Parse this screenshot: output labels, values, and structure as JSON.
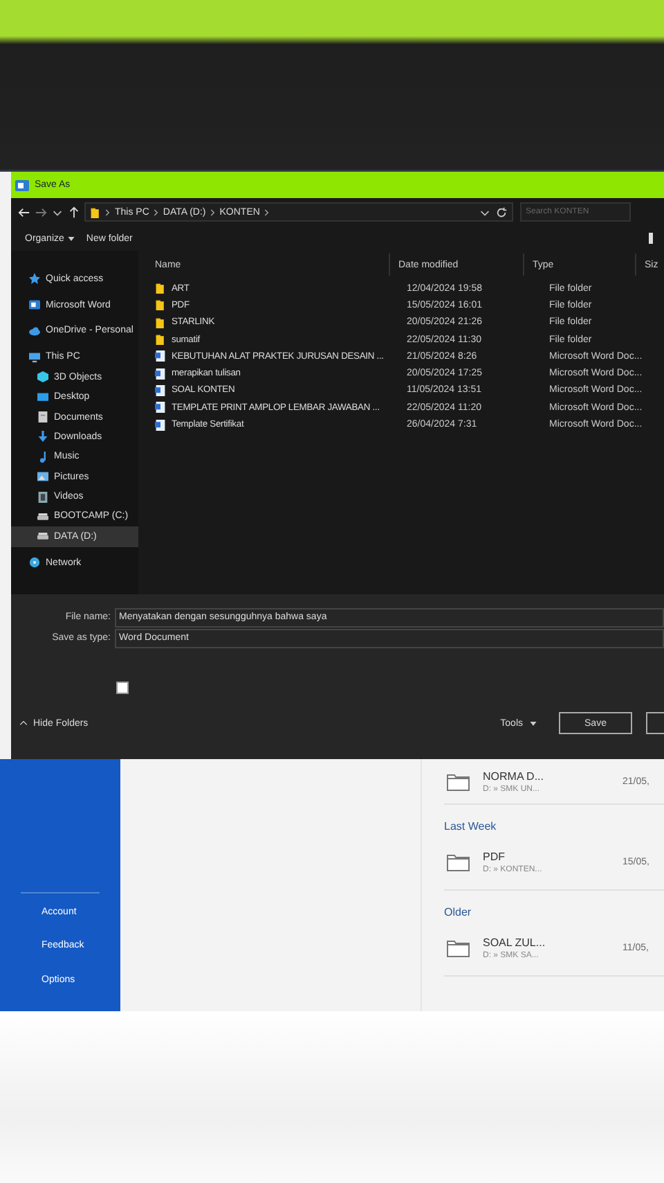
{
  "window": {
    "title": "Save As"
  },
  "nav": {
    "breadcrumb": [
      "This PC",
      "DATA (D:)",
      "KONTEN"
    ],
    "search": {
      "placeholder": "Search KONTEN"
    }
  },
  "toolbar": {
    "organize": "Organize",
    "new_folder": "New folder"
  },
  "columns": [
    "Name",
    "Date modified",
    "Type",
    "Siz"
  ],
  "sidebar": {
    "items": [
      {
        "label": "Quick access",
        "kind": "star",
        "selected": false
      },
      {
        "label": "Microsoft Word",
        "kind": "word",
        "selected": false
      },
      {
        "label": "OneDrive - Personal",
        "kind": "cloud",
        "selected": false
      },
      {
        "label": "This PC",
        "kind": "pc",
        "selected": false,
        "children": [
          {
            "label": "3D Objects",
            "kind": "cube",
            "selected": false
          },
          {
            "label": "Desktop",
            "kind": "desktop",
            "selected": false
          },
          {
            "label": "Documents",
            "kind": "doc",
            "selected": false
          },
          {
            "label": "Downloads",
            "kind": "download",
            "selected": false
          },
          {
            "label": "Music",
            "kind": "music",
            "selected": false
          },
          {
            "label": "Pictures",
            "kind": "picture",
            "selected": false
          },
          {
            "label": "Videos",
            "kind": "video",
            "selected": false
          },
          {
            "label": "BOOTCAMP (C:)",
            "kind": "drive",
            "selected": false
          },
          {
            "label": "DATA (D:)",
            "kind": "drive",
            "selected": true
          }
        ]
      },
      {
        "label": "Network",
        "kind": "network",
        "selected": false
      }
    ]
  },
  "files": [
    {
      "name": "ART",
      "date": "12/04/2024 19:58",
      "type": "File folder",
      "kind": "folder"
    },
    {
      "name": "PDF",
      "date": "15/05/2024 16:01",
      "type": "File folder",
      "kind": "folder"
    },
    {
      "name": "STARLINK",
      "date": "20/05/2024 21:26",
      "type": "File folder",
      "kind": "folder"
    },
    {
      "name": "sumatif",
      "date": "22/05/2024 11:30",
      "type": "File folder",
      "kind": "folder"
    },
    {
      "name": "KEBUTUHAN ALAT PRAKTEK JURUSAN DESAIN ...",
      "date": "21/05/2024 8:26",
      "type": "Microsoft Word Doc...",
      "kind": "doc"
    },
    {
      "name": "merapikan tulisan",
      "date": "20/05/2024 17:25",
      "type": "Microsoft Word Doc...",
      "kind": "doc"
    },
    {
      "name": "SOAL KONTEN",
      "date": "11/05/2024 13:51",
      "type": "Microsoft Word Doc...",
      "kind": "doc"
    },
    {
      "name": "TEMPLATE PRINT AMPLOP LEMBAR JAWABAN ...",
      "date": "22/05/2024 11:20",
      "type": "Microsoft Word Doc...",
      "kind": "doc"
    },
    {
      "name": "Template Sertifikat",
      "date": "26/04/2024 7:31",
      "type": "Microsoft Word Doc...",
      "kind": "doc"
    }
  ],
  "form": {
    "file_name": {
      "label": "File name:",
      "value": "Menyatakan dengan sesungguhnya bahwa saya"
    },
    "save_as_type": {
      "label": "Save as type:",
      "value": "Word Document"
    },
    "thumbnail_checkbox": {
      "checked": false
    },
    "hide_folders": "Hide Folders",
    "tools": "Tools",
    "save": "Save"
  },
  "backstage": {
    "nav": [
      "Account",
      "Feedback",
      "Options"
    ],
    "groups": [
      {
        "items": [
          {
            "name": "NORMA D...",
            "path": "D: » SMK UN...",
            "date": "21/05,"
          }
        ]
      },
      {
        "heading": "Last Week",
        "items": [
          {
            "name": "PDF",
            "path": "D: » KONTEN...",
            "date": "15/05,"
          }
        ]
      },
      {
        "heading": "Older",
        "items": [
          {
            "name": "SOAL ZUL...",
            "path": "D: » SMK SA...",
            "date": "11/05,"
          }
        ]
      }
    ]
  }
}
